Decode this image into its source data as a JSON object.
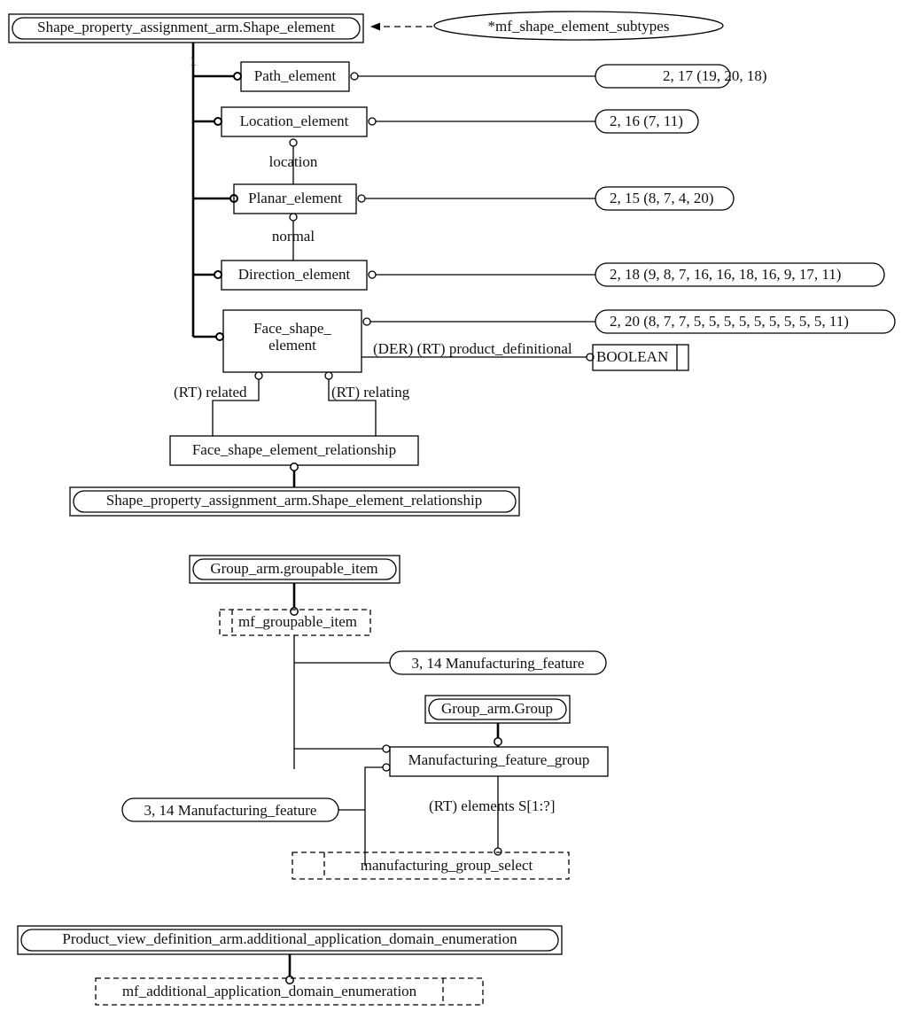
{
  "diagram": {
    "title": "EXPRESS-G manufacturing feature ARM diagram",
    "notation": "EXPRESS-G",
    "stroke_color": "#000000",
    "text_color": "#111111",
    "background_color": "#ffffff"
  },
  "entities": {
    "shape_element_ref": "Shape_property_assignment_arm.Shape_element",
    "path_element": "Path_element",
    "location_element": "Location_element",
    "planar_element": "Planar_element",
    "direction_element": "Direction_element",
    "face_shape_element_l1": "Face_shape_",
    "face_shape_element_l2": "element",
    "face_shape_element_relationship": "Face_shape_element_relationship",
    "shape_element_relationship_ref": "Shape_property_assignment_arm.Shape_element_relationship",
    "groupable_item_ref": "Group_arm.groupable_item",
    "group_ref": "Group_arm.Group",
    "manufacturing_feature_group": "Manufacturing_feature_group",
    "product_view_definition_ref": "Product_view_definition_arm.additional_application_domain_enumeration",
    "boolean_type": "BOOLEAN"
  },
  "select_types": {
    "mf_shape_element_subtypes": "*mf_shape_element_subtypes",
    "mf_groupable_item": "mf_groupable_item",
    "manufacturing_group_select": "manufacturing_group_select",
    "mf_additional_application_domain_enumeration": "mf_additional_application_domain_enumeration"
  },
  "page_refs": {
    "path_element_ref": "2, 17 (19, 20, 18)",
    "location_element_ref": "2, 16 (7, 11)",
    "planar_element_ref": "2, 15 (8, 7, 4, 20)",
    "direction_element_ref": "2, 18 (9, 8, 7, 16, 16, 18, 16, 9, 17, 11)",
    "face_shape_element_ref": "2, 20 (8, 7, 7, 5, 5, 5, 5, 5, 5, 5, 5, 5, 11)",
    "manufacturing_feature_upper": "3, 14 Manufacturing_feature",
    "manufacturing_feature_lower": "3, 14 Manufacturing_feature"
  },
  "attribute_labels": {
    "supertype_count": "1",
    "location": "location",
    "normal": "normal",
    "product_definitional": "(DER) (RT) product_definitional",
    "rt_related": "(RT) related",
    "rt_relating": "(RT) relating",
    "rt_elements": "(RT) elements S[1:?]"
  }
}
